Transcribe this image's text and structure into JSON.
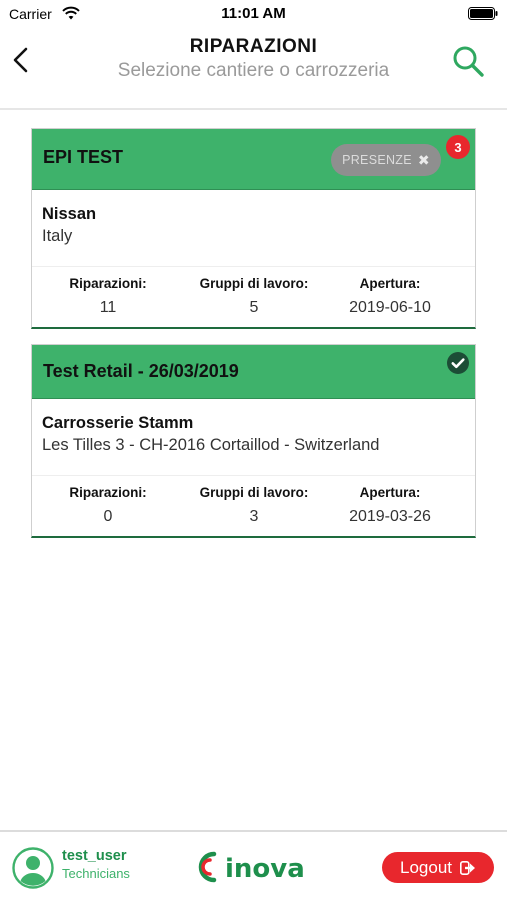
{
  "status_bar": {
    "carrier": "Carrier",
    "time": "11:01 AM"
  },
  "header": {
    "title": "RIPARAZIONI",
    "subtitle": "Selezione cantiere o carrozzeria"
  },
  "stat_labels": {
    "repairs": "Riparazioni:",
    "work_groups": "Gruppi di lavoro:",
    "opening": "Apertura:"
  },
  "cards": [
    {
      "title": "EPI TEST",
      "presenze_label": "PRESENZE",
      "badge_count": "3",
      "client": "Nissan",
      "location": "Italy",
      "repairs": "11",
      "work_groups": "5",
      "opening": "2019-06-10"
    },
    {
      "title": "Test Retail - 26/03/2019",
      "status_icon": "check-circle-icon",
      "client": "Carrosserie Stamm",
      "location": "Les Tilles 3 - CH-2016 Cortaillod - Switzerland",
      "repairs": "0",
      "work_groups": "3",
      "opening": "2019-03-26"
    }
  ],
  "footer": {
    "username": "test_user",
    "role": "Technicians",
    "logo_text": "inova",
    "logout_label": "Logout"
  },
  "colors": {
    "accent_green": "#3eb26b",
    "dark_green": "#1e6b3d",
    "badge_red": "#e8272d",
    "logout_red": "#e8272d"
  }
}
